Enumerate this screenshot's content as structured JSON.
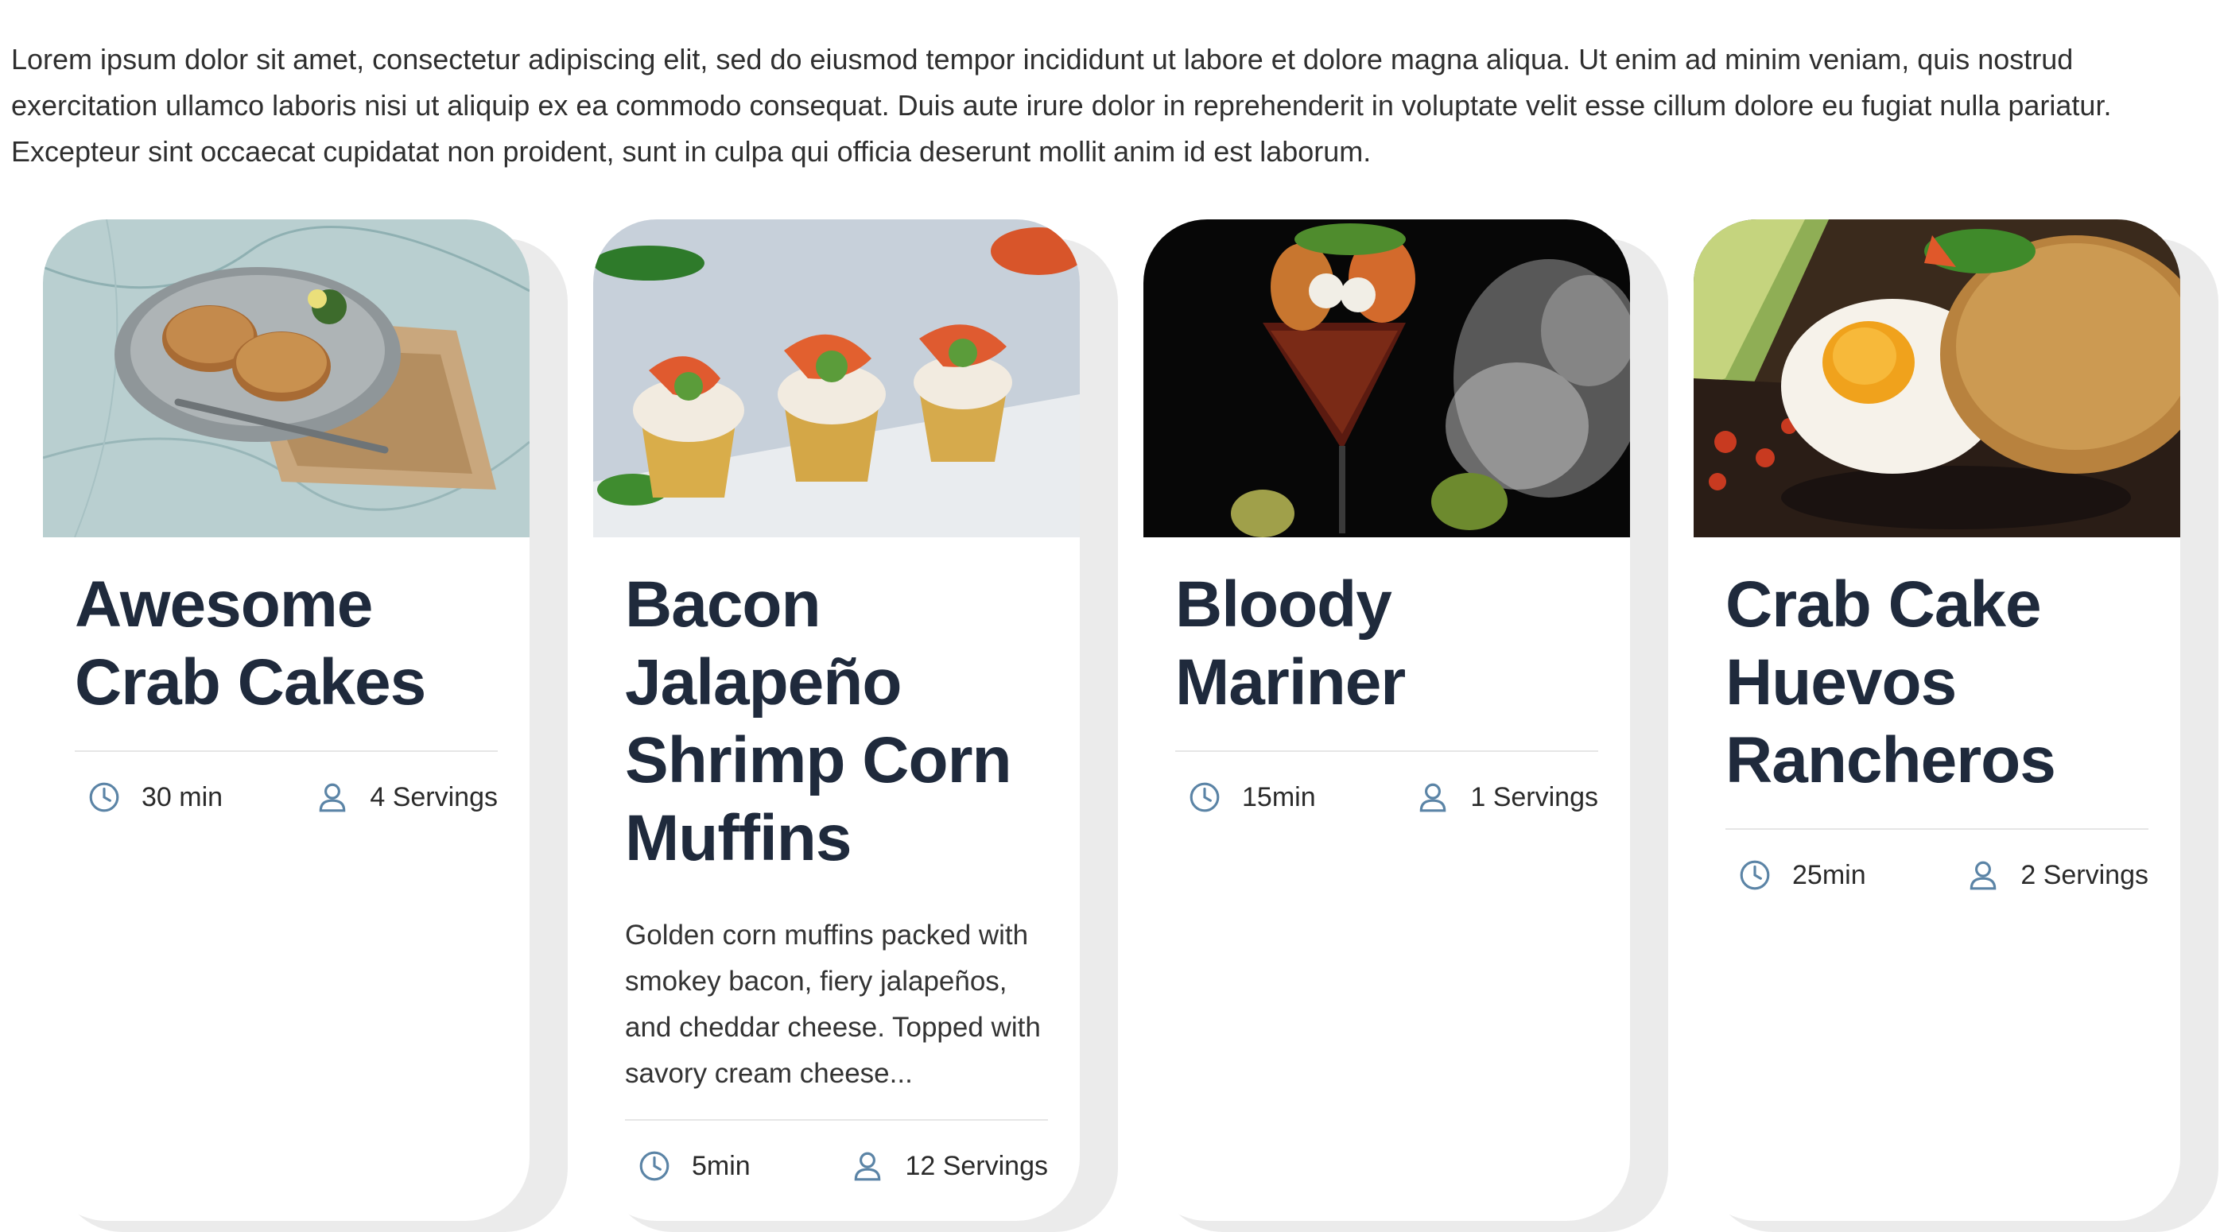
{
  "intro": {
    "text": "Lorem ipsum dolor sit amet, consectetur adipiscing elit, sed do eiusmod tempor incididunt ut labore et dolore magna aliqua. Ut enim ad minim veniam, quis nostrud exercitation ullamco laboris nisi ut aliquip ex ea commodo consequat. Duis aute irure dolor in reprehenderit in voluptate velit esse cillum dolore eu fugiat nulla pariatur. Excepteur sint occaecat cupidatat non proident, sunt in culpa qui officia deserunt mollit anim id est laborum."
  },
  "colors": {
    "heading_blue": "#163f99",
    "title": "#1f2a3c",
    "icon": "#5b84a6"
  },
  "icons": {
    "time": "clock-icon",
    "servings": "person-icon"
  },
  "cards": [
    {
      "title": "Awesome Crab Cakes",
      "description": "",
      "time": "30 min",
      "servings": "4 Servings",
      "image": "crab-cakes-photo"
    },
    {
      "title": "Bacon Jalapeño Shrimp Corn Muffins",
      "description": "Golden corn muffins packed with smokey bacon, fiery jalapeños, and cheddar cheese. Topped with savory cream cheese...",
      "time": "5min",
      "servings": "12 Servings",
      "image": "shrimp-corn-muffins-photo"
    },
    {
      "title": "Bloody Mariner",
      "description": "",
      "time": "15min",
      "servings": "1 Servings",
      "image": "bloody-mariner-photo"
    },
    {
      "title": "Crab Cake Huevos Rancheros",
      "description": "",
      "time": "25min",
      "servings": "2 Servings",
      "image": "huevos-rancheros-photo"
    }
  ]
}
